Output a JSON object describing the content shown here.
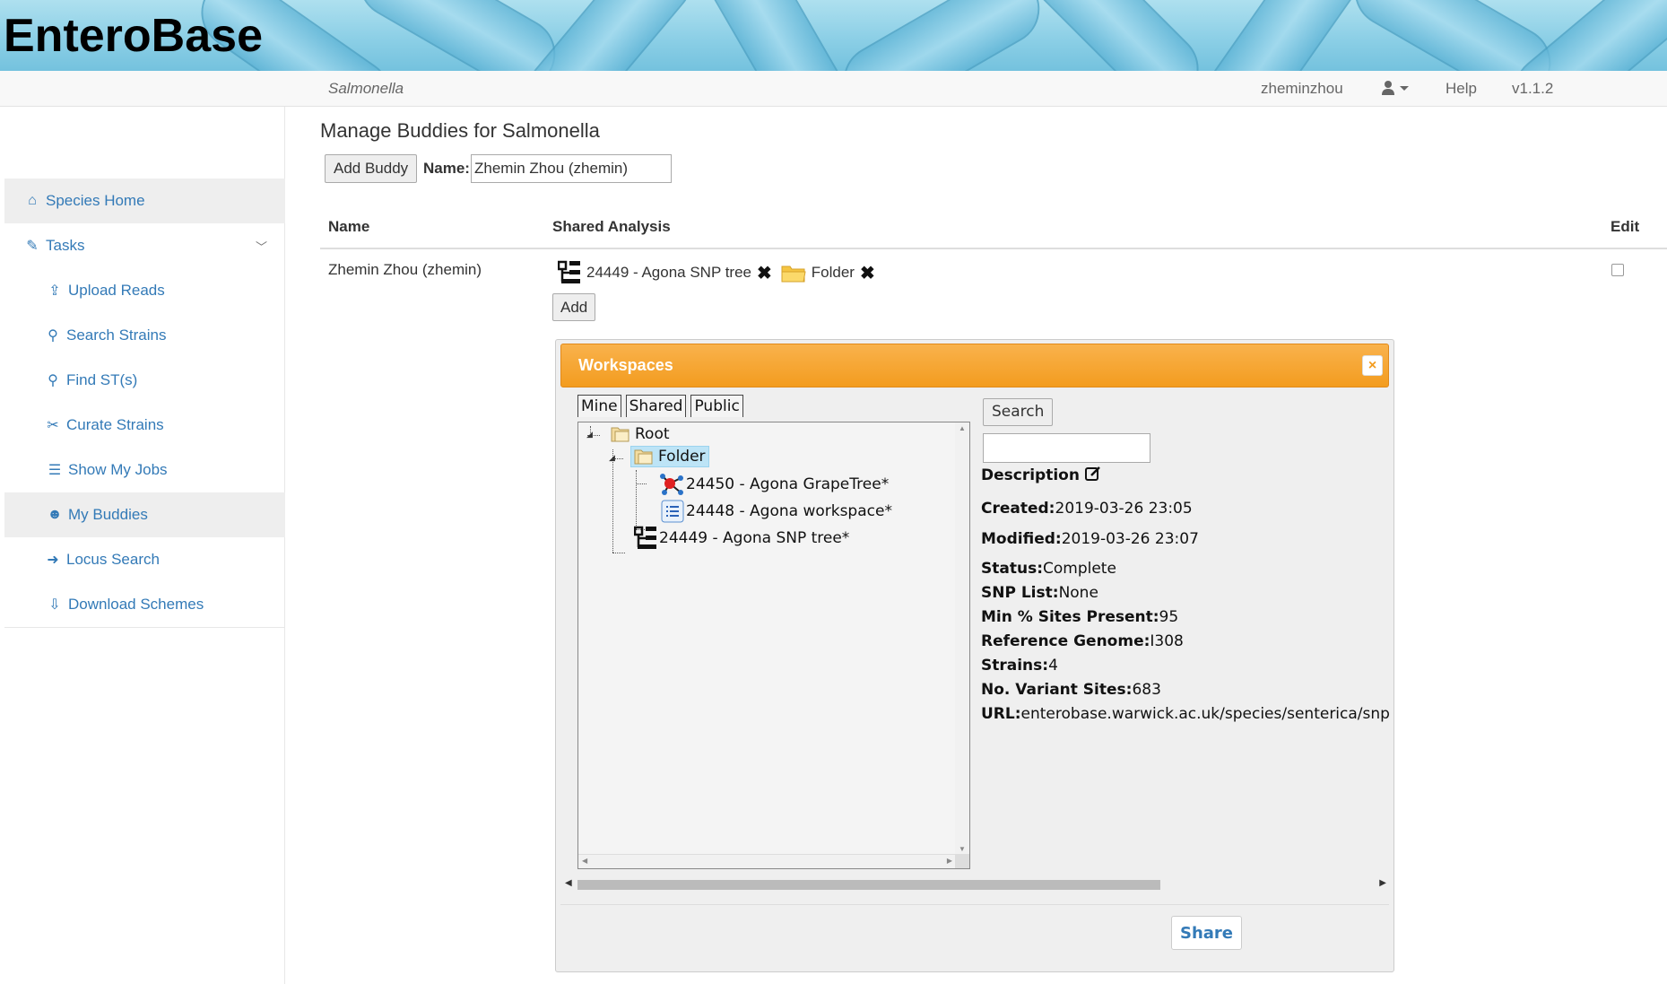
{
  "app": {
    "logo": "EnteroBase",
    "species": "Salmonella"
  },
  "topnav": {
    "username": "zheminzhou",
    "help": "Help",
    "version": "v1.1.2"
  },
  "sidebar": {
    "items": [
      {
        "label": "Species Home",
        "icon": "home-icon",
        "glyph": "⌂"
      },
      {
        "label": "Tasks",
        "icon": "wrench-icon",
        "glyph": "✎"
      },
      {
        "label": "Upload Reads",
        "icon": "upload-icon",
        "glyph": "⇪"
      },
      {
        "label": "Search Strains",
        "icon": "search-strains-icon",
        "glyph": "⚲"
      },
      {
        "label": "Find ST(s)",
        "icon": "search-icon",
        "glyph": "⚲"
      },
      {
        "label": "Curate Strains",
        "icon": "curate-icon",
        "glyph": "✂"
      },
      {
        "label": "Show My Jobs",
        "icon": "list-icon",
        "glyph": "☰"
      },
      {
        "label": "My Buddies",
        "icon": "users-icon",
        "glyph": "☻"
      },
      {
        "label": "Locus Search",
        "icon": "arrow-right-icon",
        "glyph": "➜"
      },
      {
        "label": "Download Schemes",
        "icon": "download-icon",
        "glyph": "⇩"
      }
    ]
  },
  "page": {
    "title": "Manage Buddies for Salmonella",
    "add_buddy_label": "Add Buddy",
    "name_label": "Name:",
    "name_value": "Zhemin Zhou (zhemin)"
  },
  "table": {
    "headers": {
      "name": "Name",
      "shared": "Shared Analysis",
      "edit": "Edit"
    },
    "row": {
      "name": "Zhemin Zhou (zhemin)",
      "shared": [
        {
          "label": "24449 - Agona SNP tree",
          "icon": "snp-tree-icon"
        },
        {
          "label": "Folder",
          "icon": "folder-icon"
        }
      ],
      "add_label": "Add",
      "edit_checked": false
    }
  },
  "dialog": {
    "title": "Workspaces",
    "close_glyph": "×",
    "tabs": [
      "Mine",
      "Shared",
      "Public"
    ],
    "tree": {
      "root": "Root",
      "folder": "Folder",
      "children": [
        "24450 - Agona GrapeTree*",
        "24448 - Agona workspace*"
      ],
      "root_child": "24449 - Agona SNP tree*"
    },
    "search_label": "Search",
    "search_value": "",
    "description_label": "Description",
    "details": [
      {
        "key": "Created:",
        "value": "2019-03-26 23:05"
      },
      {
        "key": "Modified:",
        "value": "2019-03-26 23:07"
      },
      {
        "key": "Status:",
        "value": "Complete"
      },
      {
        "key": "SNP List:",
        "value": "None"
      },
      {
        "key": "Min % Sites Present:",
        "value": "95"
      },
      {
        "key": "Reference Genome:",
        "value": "I308"
      },
      {
        "key": "Strains:",
        "value": "4"
      },
      {
        "key": "No. Variant Sites:",
        "value": "683"
      },
      {
        "key": "URL:",
        "value": "enterobase.warwick.ac.uk/species/senterica/snp"
      }
    ],
    "share_label": "Share"
  },
  "colors": {
    "accent": "#f39c1f",
    "link": "#337ab7"
  }
}
